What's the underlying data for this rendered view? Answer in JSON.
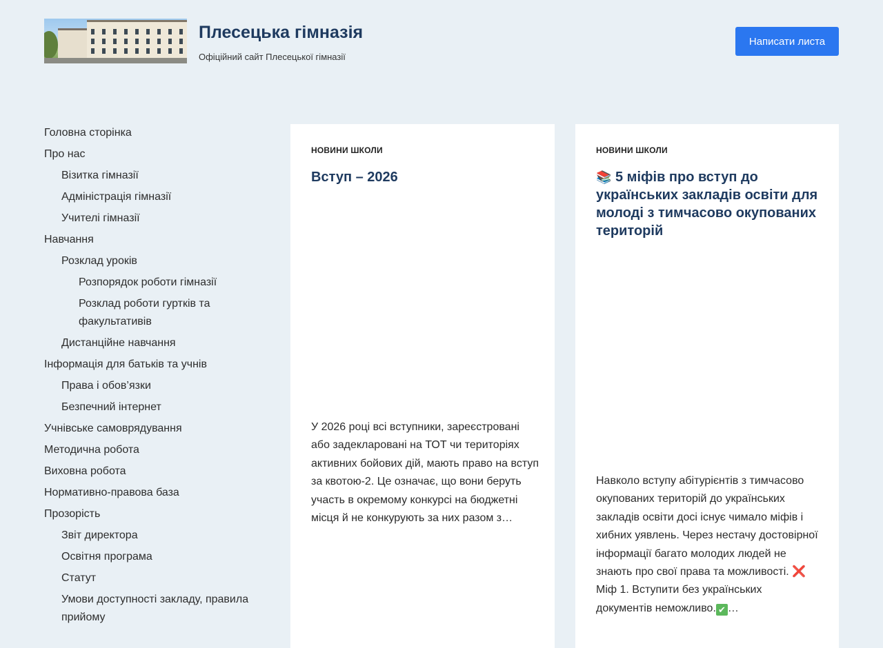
{
  "header": {
    "site_title": "Плесецька гімназія",
    "tagline": "Офіційний сайт Плесецької гімназії",
    "cta_label": "Написати листа"
  },
  "nav": {
    "items": [
      {
        "label": "Головна сторінка",
        "level": 0
      },
      {
        "label": "Про нас",
        "level": 0
      },
      {
        "label": "Візитка гімназії",
        "level": 1
      },
      {
        "label": "Адміністрація гімназії",
        "level": 1
      },
      {
        "label": "Учителі гімназії",
        "level": 1
      },
      {
        "label": "Навчання",
        "level": 0
      },
      {
        "label": "Розклад уроків",
        "level": 1
      },
      {
        "label": "Розпорядок роботи гімназії",
        "level": 2
      },
      {
        "label": "Розклад роботи гуртків та факультативів",
        "level": 2
      },
      {
        "label": "Дистанційне навчання",
        "level": 1
      },
      {
        "label": "Інформація для батьків та учнів",
        "level": 0
      },
      {
        "label": "Права і обов’язки",
        "level": 1
      },
      {
        "label": "Безпечний інтернет",
        "level": 1
      },
      {
        "label": "Учнівське самоврядування",
        "level": 0
      },
      {
        "label": "Методична робота",
        "level": 0
      },
      {
        "label": "Виховна робота",
        "level": 0
      },
      {
        "label": "Нормативно-правова база",
        "level": 0
      },
      {
        "label": "Прозорість",
        "level": 0
      },
      {
        "label": "Звіт директора",
        "level": 1
      },
      {
        "label": "Освітня програма",
        "level": 1
      },
      {
        "label": "Статут",
        "level": 1
      },
      {
        "label": "Умови доступності закладу, правила прийому",
        "level": 1
      }
    ]
  },
  "posts": [
    {
      "category": "НОВИНИ ШКОЛИ",
      "title": "Вступ – 2026",
      "excerpt": "У 2026 році всі вступники, зареєстровані або задекларовані на ТОТ чи територіях активних бойових дій, мають право на вступ за квотою-2. Це означає, що вони беруть участь в окремому конкурсі на бюджетні місця й не конкурують за них разом з…"
    },
    {
      "category": "НОВИНИ ШКОЛИ",
      "title_emoji": "📚",
      "title": "5 міфів про вступ до українських закладів освіти для молоді з тимчасово окупованих територій",
      "excerpt_part1": "Навколо вступу абітурієнтів з тимчасово окупованих територій до українських закладів освіти досі існує чимало міфів і хибних уявлень. Через нестачу достовірної інформації багато молодих людей не знають про свої права та можливості.",
      "excerpt_x": "❌",
      "excerpt_part2": "Міф 1. Вступити без українських документів неможливо.",
      "excerpt_check": "✔",
      "excerpt_ellipsis": "…"
    }
  ],
  "colors": {
    "page_bg": "#e9f0f5",
    "title": "#1e3a5f",
    "cta_bg": "#2b77f0"
  },
  "icons": {
    "books": "books-emoji-icon",
    "cross": "red-cross-icon",
    "check": "green-check-icon"
  }
}
